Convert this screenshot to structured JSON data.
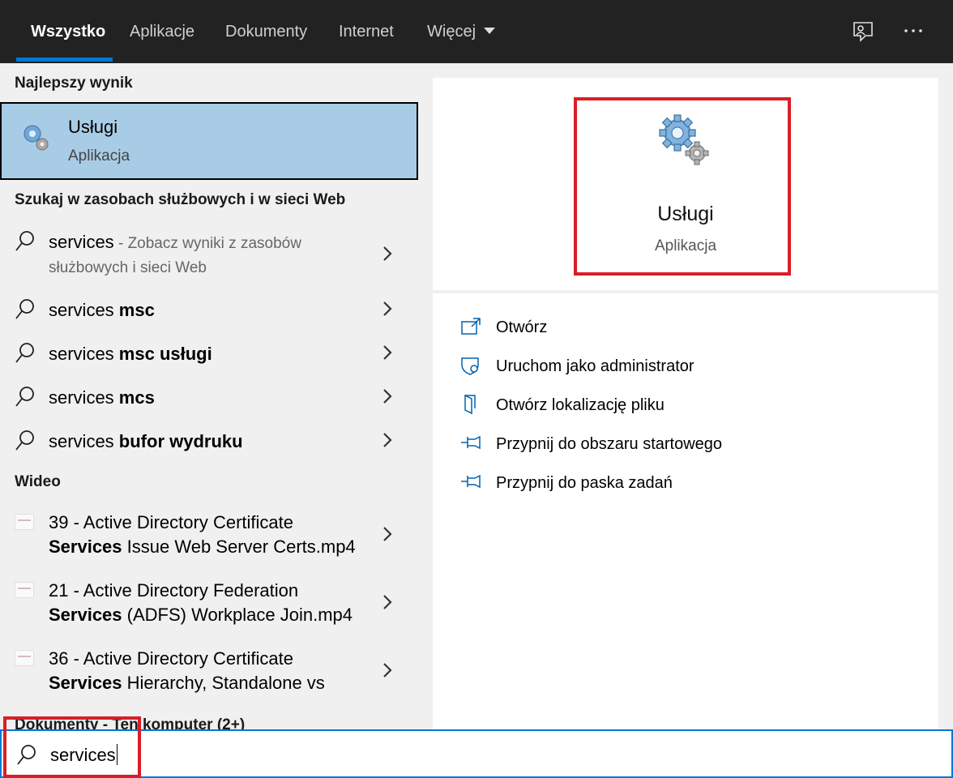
{
  "tabs": [
    {
      "label": "Wszystko",
      "active": true
    },
    {
      "label": "Aplikacje"
    },
    {
      "label": "Dokumenty"
    },
    {
      "label": "Internet"
    },
    {
      "label": "Więcej"
    }
  ],
  "icons": {
    "feedback": "feedback-icon",
    "more": "more-options-icon"
  },
  "left": {
    "best_header": "Najlepszy wynik",
    "best": {
      "title": "Usługi",
      "subtitle": "Aplikacja"
    },
    "web_header": "Szukaj w zasobach służbowych i w sieci Web",
    "web_results": [
      {
        "query": "services",
        "hint": " - Zobacz wyniki z zasobów",
        "hint2": "służbowych i sieci Web"
      },
      {
        "query": "services ",
        "bold": "msc"
      },
      {
        "query": "services ",
        "bold": "msc usługi"
      },
      {
        "query": "services ",
        "bold": "mcs"
      },
      {
        "query": "services ",
        "bold": "bufor wydruku"
      }
    ],
    "video_header": "Wideo",
    "videos": [
      {
        "line1": "39 - Active Directory Certificate",
        "line2_bold": "Services",
        "line2": " Issue Web Server Certs.mp4"
      },
      {
        "line1": "21 - Active Directory Federation",
        "line2_bold": "Services",
        "line2": " (ADFS) Workplace Join.mp4"
      },
      {
        "line1": "36 - Active Directory Certificate",
        "line2_bold": "Services",
        "line2": " Hierarchy, Standalone vs"
      }
    ],
    "docs_header": "Dokumenty - Ten komputer (2+)"
  },
  "right": {
    "title": "Usługi",
    "subtitle": "Aplikacja",
    "actions": [
      {
        "label": "Otwórz",
        "icon": "open-icon"
      },
      {
        "label": "Uruchom jako administrator",
        "icon": "admin-shield-icon"
      },
      {
        "label": "Otwórz lokalizację pliku",
        "icon": "file-location-icon"
      },
      {
        "label": "Przypnij do obszaru startowego",
        "icon": "pin-start-icon"
      },
      {
        "label": "Przypnij do paska zadań",
        "icon": "pin-taskbar-icon"
      }
    ]
  },
  "search": {
    "value": "services"
  },
  "colors": {
    "accent": "#0078d7",
    "highlight": "#d91e27",
    "selected": "#a9cce6"
  }
}
